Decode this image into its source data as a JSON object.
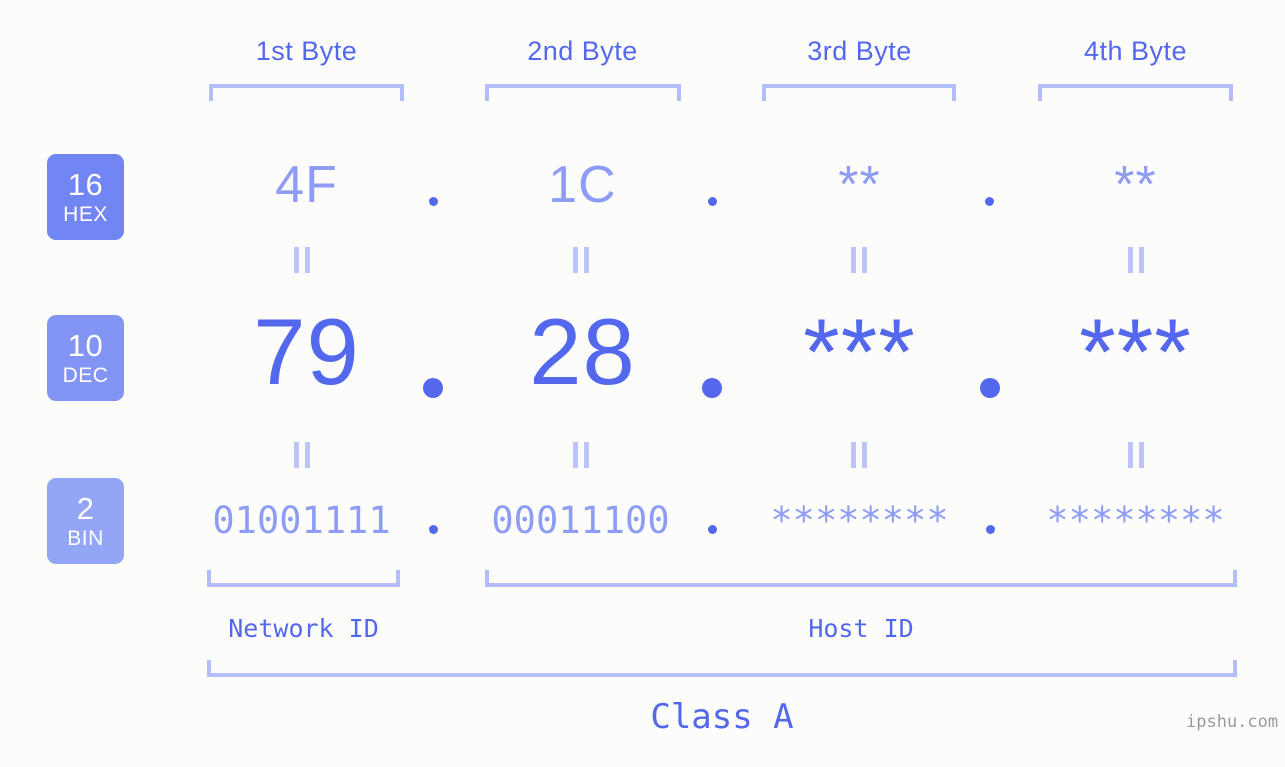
{
  "background_color": "#fcfdfa",
  "accent_color": "#5468ee",
  "accent_light": "#8e9cf5",
  "bracket_color": "#b5bdf9",
  "byte_headers": [
    {
      "label": "1st Byte"
    },
    {
      "label": "2nd Byte"
    },
    {
      "label": "3rd Byte"
    },
    {
      "label": "4th Byte"
    }
  ],
  "rows": [
    {
      "badge": {
        "number": "16",
        "name": "HEX",
        "color": "#7186f2"
      },
      "values": [
        "4F",
        "1C",
        "**",
        "**"
      ],
      "separators": [
        ".",
        ".",
        "."
      ]
    },
    {
      "badge": {
        "number": "10",
        "name": "DEC",
        "color": "#8294f4"
      },
      "values": [
        "79",
        "28",
        "***",
        "***"
      ],
      "separators": [
        ".",
        ".",
        "."
      ]
    },
    {
      "badge": {
        "number": "2",
        "name": "BIN",
        "color": "#93a6f6"
      },
      "values": [
        "01001111",
        "00011100",
        "********",
        "********"
      ],
      "separators": [
        ".",
        ".",
        "."
      ]
    }
  ],
  "equals_marks": "||",
  "id_sections": [
    {
      "label": "Network ID"
    },
    {
      "label": "Host ID"
    }
  ],
  "class_label": "Class A",
  "watermark": "ipshu.com"
}
